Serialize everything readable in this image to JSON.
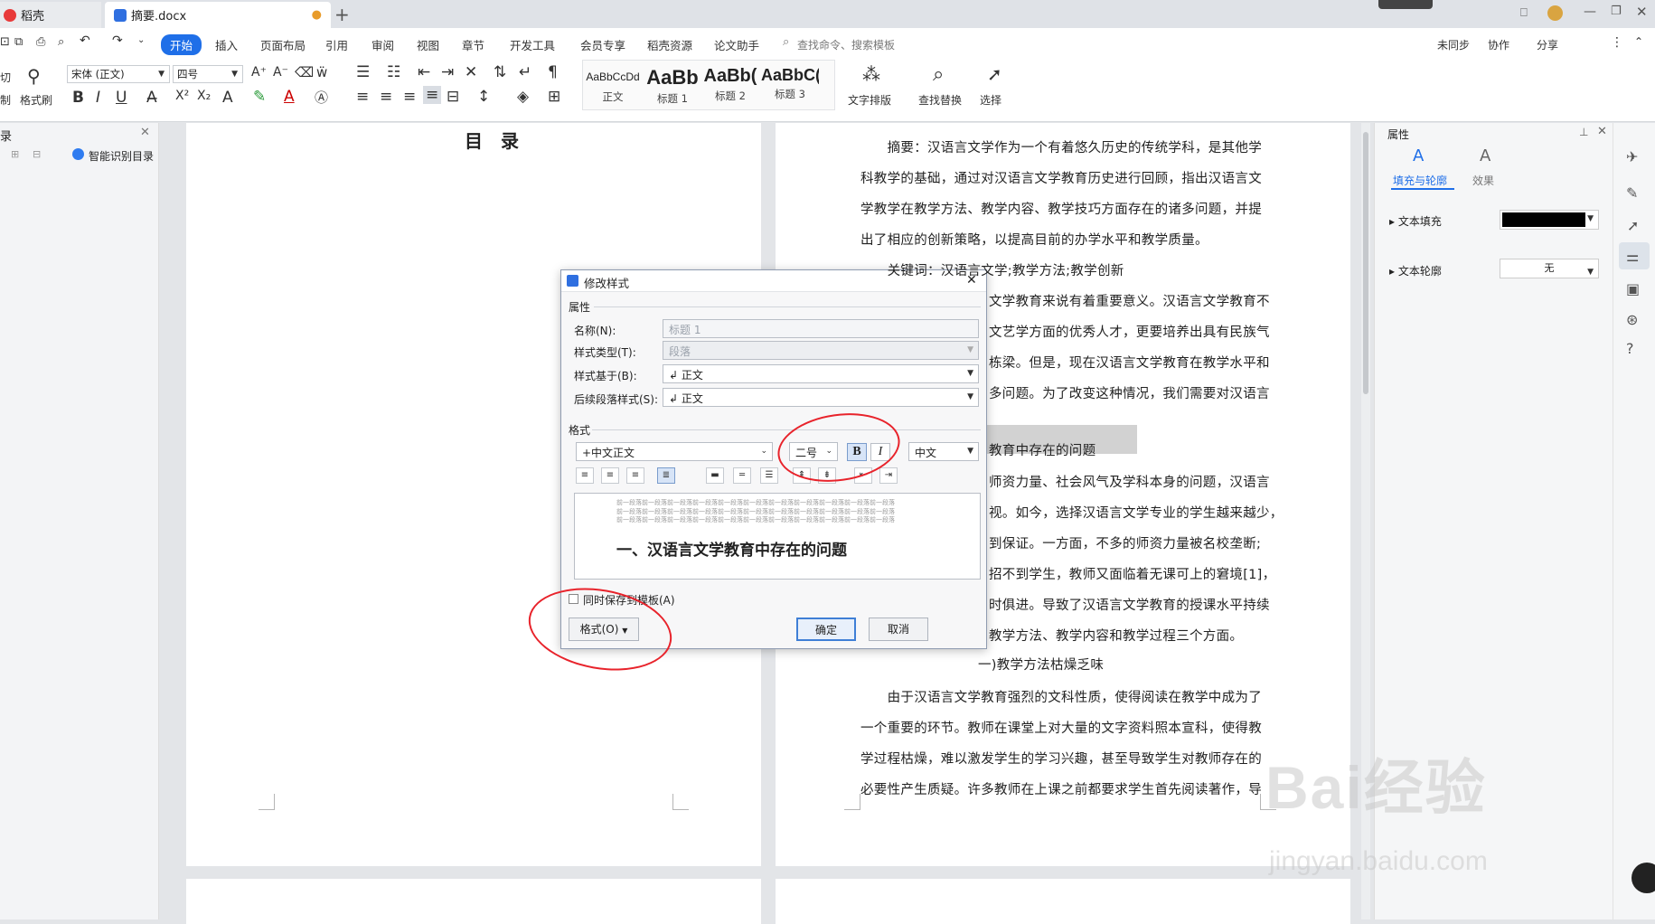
{
  "tabs": {
    "home": "稻壳",
    "doc": "摘要.docx"
  },
  "menu": [
    "开始",
    "插入",
    "页面布局",
    "引用",
    "审阅",
    "视图",
    "章节",
    "开发工具",
    "会员专享",
    "稻壳资源",
    "论文助手"
  ],
  "search_placeholder": "查找命令、搜索模板",
  "top_right": {
    "sync": "未同步",
    "collab": "协作",
    "share": "分享"
  },
  "ribbon": {
    "cut": "切",
    "copy": "制",
    "format_brush": "格式刷",
    "font": "宋体 (正文)",
    "size": "四号",
    "styles": [
      {
        "preview": "AaBbCcDd",
        "label": "正文"
      },
      {
        "preview": "AaBb",
        "label": "标题 1"
      },
      {
        "preview": "AaBb(",
        "label": "标题 2"
      },
      {
        "preview": "AaBbC(",
        "label": "标题 3"
      }
    ],
    "text_layout": "文字排版",
    "find_replace": "查找替换",
    "select": "选择"
  },
  "left_panel": {
    "title": "录",
    "smart_toc": "智能识别目录"
  },
  "page1": {
    "title": "目　录"
  },
  "page2": {
    "lines": [
      "　　摘要：汉语言文学作为一个有着悠久历史的传统学科，是其他学",
      "科教学的基础，通过对汉语言文学教育历史进行回顾，指出汉语言文",
      "学教学在教学方法、教学内容、教学技巧方面存在的诸多问题，并提",
      "出了相应的创新策略，以提高目前的办学水平和教学质量。",
      "　　关键词：汉语言文学;教学方法;教学创新",
      "文学教育来说有着重要意义。汉语言文学教育不",
      "文艺学方面的优秀人才，更要培养出具有民族气",
      "栋梁。但是，现在汉语言文学教育在教学水平和",
      "多问题。为了改变这种情况，我们需要对汉语言",
      "",
      "教育中存在的问题",
      "师资力量、社会风气及学科本身的问题，汉语言",
      "视。如今，选择汉语言文学专业的学生越来越少，",
      "到保证。一方面，不多的师资力量被名校垄断;",
      "招不到学生，教师又面临着无课可上的窘境[1]，",
      "时俱进。导致了汉语言文学教育的授课水平持续",
      "教学方法、教学内容和教学过程三个方面。",
      "一)教学方法枯燥乏味",
      "　　由于汉语言文学教育强烈的文科性质，使得阅读在教学中成为了",
      "一个重要的环节。教师在课堂上对大量的文字资料照本宣科，使得教",
      "学过程枯燥，难以激发学生的学习兴趣，甚至导致学生对教师存在的",
      "必要性产生质疑。许多教师在上课之前都要求学生首先阅读著作，导"
    ]
  },
  "right_panel": {
    "title": "属性",
    "tab_fill": "填充与轮廓",
    "tab_effect": "效果",
    "text_fill": "文本填充",
    "text_outline": "文本轮廓",
    "outline_value": "无",
    "fill_color": "#000000"
  },
  "dialog": {
    "title": "修改样式",
    "section_props": "属性",
    "name_label": "名称(N):",
    "name_value": "标题 1",
    "type_label": "样式类型(T):",
    "type_value": "段落",
    "based_label": "样式基于(B):",
    "based_value": "↲ 正文",
    "next_label": "后续段落样式(S):",
    "next_value": "↲ 正文",
    "section_format": "格式",
    "font_value": "+中文正文",
    "size_value": "二号",
    "bold": "B",
    "italic": "I",
    "lang_value": "中文",
    "preview_filler": "前一段落前一段落前一段落前一段落前一段落前一段落前一段落前一段落前一段落前一段落前一段落",
    "preview_heading": "一、汉语言文学教育中存在的问题",
    "save_template": "同时保存到模板(A)",
    "format_button": "格式(O)",
    "ok": "确定",
    "cancel": "取消"
  },
  "watermark": {
    "brand": "Bai经验",
    "url": "jingyan.baidu.com"
  },
  "accent": "#1f6fe8"
}
